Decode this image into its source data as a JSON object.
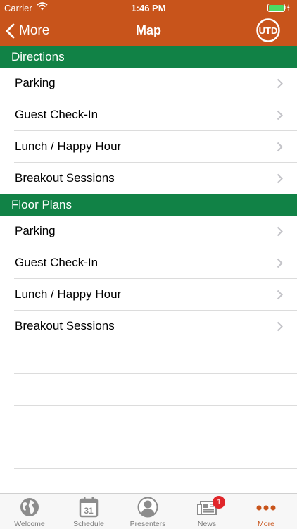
{
  "status_bar": {
    "carrier": "Carrier",
    "time": "1:46 PM"
  },
  "nav": {
    "back_label": "More",
    "title": "Map",
    "logo_text": "UTD"
  },
  "sections": [
    {
      "title": "Directions",
      "items": [
        "Parking",
        "Guest Check-In",
        "Lunch / Happy Hour",
        "Breakout Sessions"
      ]
    },
    {
      "title": "Floor Plans",
      "items": [
        "Parking",
        "Guest Check-In",
        "Lunch / Happy Hour",
        "Breakout Sessions"
      ]
    }
  ],
  "tabbar": {
    "tabs": [
      {
        "label": "Welcome",
        "icon": "globe-icon"
      },
      {
        "label": "Schedule",
        "icon": "calendar-icon",
        "icon_text": "31"
      },
      {
        "label": "Presenters",
        "icon": "person-icon"
      },
      {
        "label": "News",
        "icon": "newspaper-icon",
        "badge": "1"
      },
      {
        "label": "More",
        "icon": "more-dots-icon"
      }
    ],
    "active": "More"
  },
  "colors": {
    "accent": "#c8541b",
    "section_header": "#118246",
    "badge": "#e0262a"
  }
}
